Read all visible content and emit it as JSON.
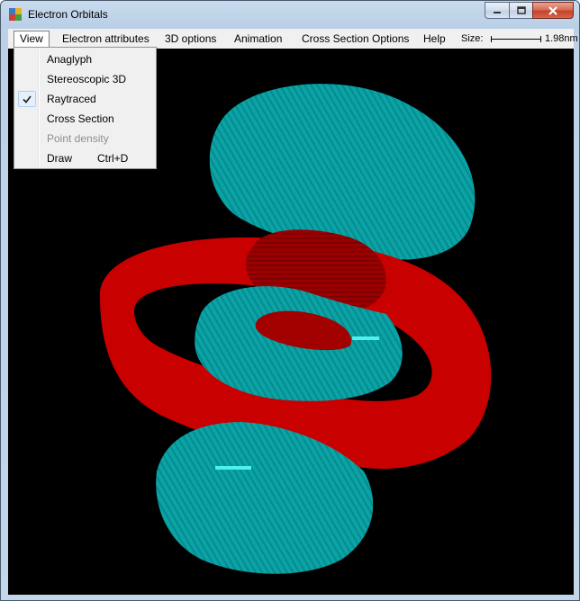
{
  "window": {
    "title": "Electron Orbitals"
  },
  "menubar": {
    "items": [
      "View",
      "Electron attributes",
      "3D options",
      "Animation",
      "Cross Section Options",
      "Help"
    ],
    "size_label": "Size:",
    "size_value": "1.98nm"
  },
  "view_menu": {
    "items": [
      {
        "label": "Anaglyph",
        "shortcut": "",
        "checked": false,
        "enabled": true
      },
      {
        "label": "Stereoscopic 3D",
        "shortcut": "",
        "checked": false,
        "enabled": true
      },
      {
        "label": "Raytraced",
        "shortcut": "",
        "checked": true,
        "enabled": true
      },
      {
        "label": "Cross Section",
        "shortcut": "",
        "checked": false,
        "enabled": true
      },
      {
        "label": "Point density",
        "shortcut": "",
        "checked": false,
        "enabled": false
      },
      {
        "label": "Draw",
        "shortcut": "Ctrl+D",
        "checked": false,
        "enabled": true
      }
    ]
  },
  "colors": {
    "lobe_cyan": "#0aa3a6",
    "lobe_red": "#c90000",
    "background": "#000000"
  }
}
